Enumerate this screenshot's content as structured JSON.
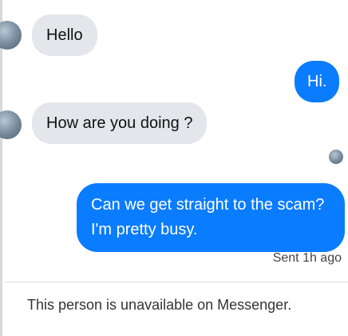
{
  "conversation": {
    "messages": [
      {
        "sender": "contact",
        "text": "Hello"
      },
      {
        "sender": "me",
        "text": "Hi."
      },
      {
        "sender": "contact",
        "text": "How are you doing ?"
      },
      {
        "sender": "me",
        "text": "Can we get straight to the scam? I'm pretty busy."
      }
    ],
    "status": "Sent 1h ago"
  },
  "footer": {
    "notice": "This person is unavailable on Messenger."
  },
  "colors": {
    "outgoing_bubble": "#0a7cff",
    "incoming_bubble": "#e4e6eb"
  }
}
